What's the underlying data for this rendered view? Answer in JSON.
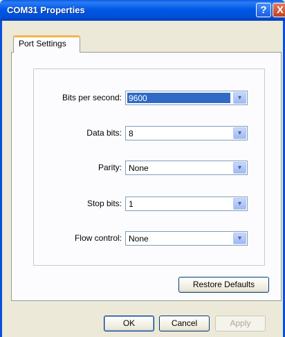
{
  "window": {
    "title": "COM31 Properties",
    "help_glyph": "?",
    "close_glyph": "X"
  },
  "tabs": [
    {
      "label": "Port Settings",
      "active": true
    }
  ],
  "settings": [
    {
      "label": "Bits per second:",
      "value": "9600",
      "selected": true
    },
    {
      "label": "Data bits:",
      "value": "8"
    },
    {
      "label": "Parity:",
      "value": "None"
    },
    {
      "label": "Stop bits:",
      "value": "1"
    },
    {
      "label": "Flow control:",
      "value": "None"
    }
  ],
  "dropdown_glyph": "▾",
  "buttons": {
    "restore_defaults": "Restore Defaults",
    "ok": "OK",
    "cancel": "Cancel",
    "apply": "Apply"
  }
}
